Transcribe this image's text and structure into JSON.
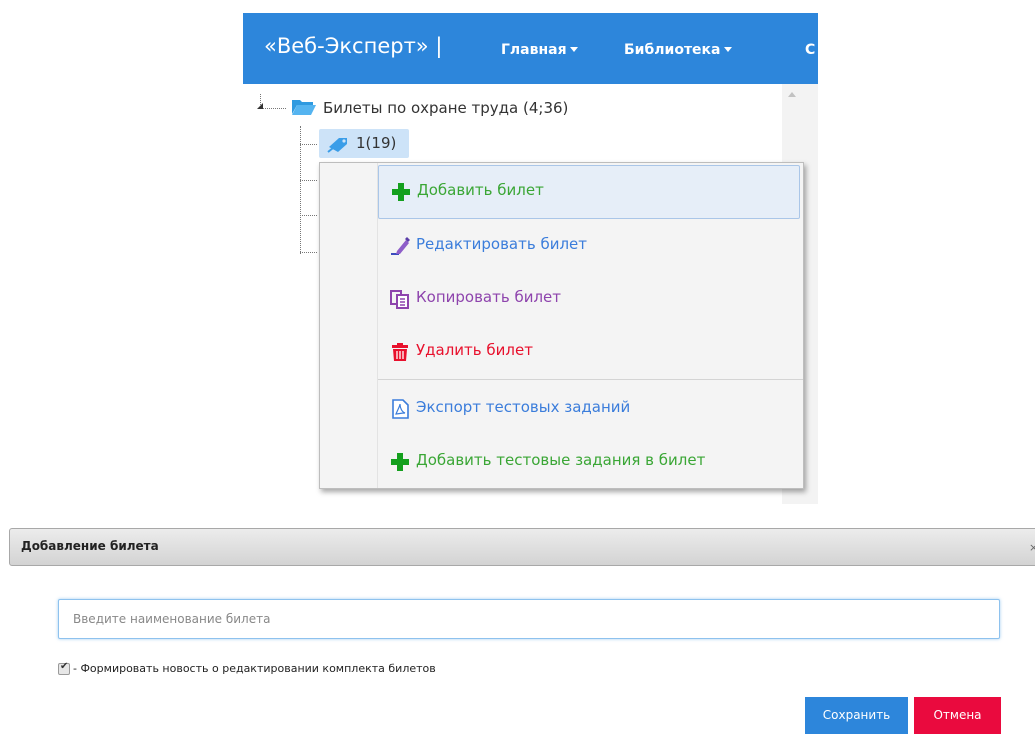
{
  "navbar": {
    "brand": "«Веб-Эксперт» |",
    "menus": [
      {
        "label": "Главная"
      },
      {
        "label": "Библиотека"
      },
      {
        "label": "С"
      }
    ],
    "color": "#2d86db"
  },
  "tree": {
    "root_label": "Билеты по охране труда (4;36)",
    "root_icon": "folder-open-icon",
    "node_label": "1(19)",
    "node_icon": "ticket-pin-icon"
  },
  "context_menu": {
    "items": [
      {
        "label": "Добавить билет",
        "icon": "plus-icon",
        "color": "#3aa635"
      },
      {
        "label": "Редактировать билет",
        "icon": "pencil-icon",
        "color": "#3b7ddb"
      },
      {
        "label": "Копировать билет",
        "icon": "copy-icon",
        "color": "#8e44ad"
      },
      {
        "label": "Удалить билет",
        "icon": "trash-icon",
        "color": "#e8102c"
      },
      {
        "label": "Экспорт тестовых заданий",
        "icon": "pdf-icon",
        "color": "#3b7ddb"
      },
      {
        "label": "Добавить тестовые задания в билет",
        "icon": "plus-icon",
        "color": "#3aa635"
      }
    ]
  },
  "dialog": {
    "title": "Добавление билета",
    "close": "×",
    "input_value": "",
    "input_placeholder": "Введите наименование билета",
    "checkbox_checked": true,
    "checkbox_mark": "✔",
    "checkbox_label": "- Формировать новость о редактировании комплекта билетов",
    "save_label": "Сохранить",
    "cancel_label": "Отмена",
    "save_color": "#2d86db",
    "cancel_color": "#ea0a3e"
  }
}
